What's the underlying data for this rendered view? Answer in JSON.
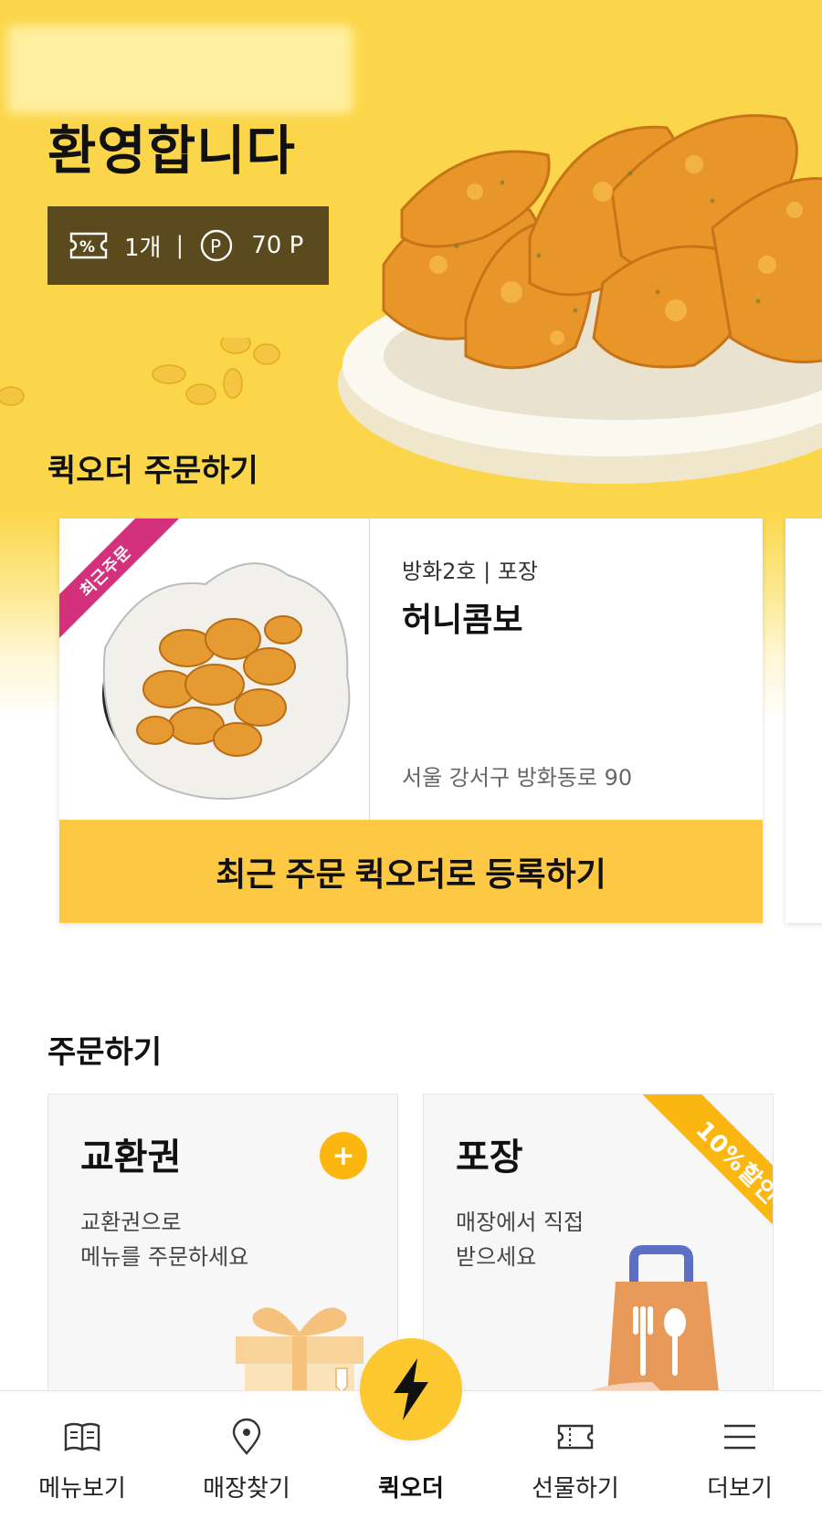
{
  "hero": {
    "welcome": "환영합니다",
    "coupon_count": "1개",
    "separator": "|",
    "points": "70 P"
  },
  "quick_order": {
    "section_title": "퀵오더 주문하기",
    "card": {
      "badge": "최근주문",
      "store": "방화2호 | 포장",
      "menu_name": "허니콤보",
      "address": "서울 강서구 방화동로 90",
      "register_button": "최근 주문 퀵오더로 등록하기"
    }
  },
  "order": {
    "section_title": "주문하기",
    "cards": [
      {
        "title": "교환권",
        "desc_line1": "교환권으로",
        "desc_line2": "메뉴를 주문하세요",
        "action_icon": "plus-icon"
      },
      {
        "title": "포장",
        "desc_line1": "매장에서 직접",
        "desc_line2": "받으세요",
        "badge": "10%할인"
      }
    ]
  },
  "bottom_nav": {
    "items": [
      {
        "label": "메뉴보기",
        "icon": "book-icon"
      },
      {
        "label": "매장찾기",
        "icon": "location-pin-icon"
      },
      {
        "label": "퀵오더",
        "icon": "lightning-icon",
        "active": true
      },
      {
        "label": "선물하기",
        "icon": "ticket-icon"
      },
      {
        "label": "더보기",
        "icon": "menu-icon"
      }
    ]
  },
  "colors": {
    "brand_yellow": "#fcd64a",
    "button_yellow": "#fdc844",
    "accent_orange": "#fbb70f",
    "wallet_brown": "#5b4a1d",
    "badge_pink": "#d4317c"
  }
}
